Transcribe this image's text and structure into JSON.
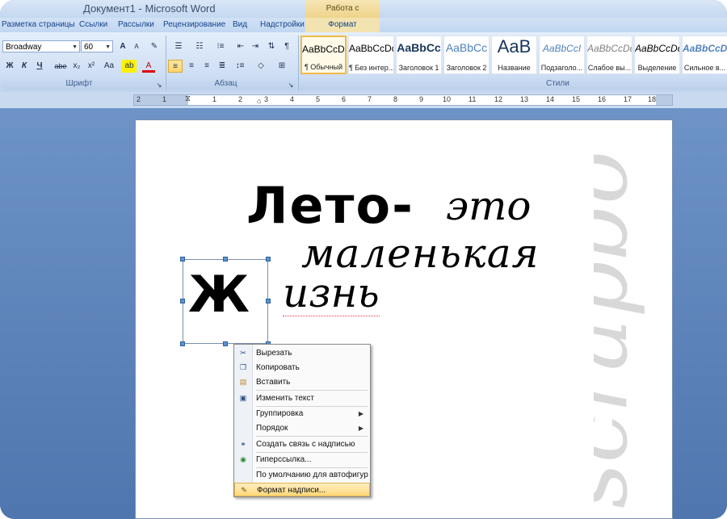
{
  "window": {
    "title": "Документ1 - Microsoft Word",
    "context_title": "Работа с надписями"
  },
  "tabs": [
    "Разметка страницы",
    "Ссылки",
    "Рассылки",
    "Рецензирование",
    "Вид",
    "Надстройки"
  ],
  "context_tab": "Формат",
  "font": {
    "name": "Broadway",
    "size": "60",
    "grow": "A",
    "shrink": "A",
    "bold": "Ж",
    "italic": "К",
    "underline": "Ч",
    "strike": "abe",
    "sub": "x₂",
    "sup": "x²",
    "case": "Aa"
  },
  "groups": {
    "font": "Шрифт",
    "paragraph": "Абзац",
    "styles": "Стили"
  },
  "styles": [
    {
      "sample": "AaBbCcDd",
      "name": "¶ Обычный"
    },
    {
      "sample": "AaBbCcDd",
      "name": "¶ Без интер..."
    },
    {
      "sample": "AaBbCc",
      "name": "Заголовок 1"
    },
    {
      "sample": "AaBbCc",
      "name": "Заголовок 2"
    },
    {
      "sample": "AaB",
      "name": "Название"
    },
    {
      "sample": "AaBbCcI",
      "name": "Подзаголо..."
    },
    {
      "sample": "AaBbCcDd",
      "name": "Слабое вы..."
    },
    {
      "sample": "AaBbCcDd",
      "name": "Выделение"
    },
    {
      "sample": "AaBbCcDd",
      "name": "Сильное в..."
    }
  ],
  "ruler": [
    "2",
    "1",
    "1",
    "1",
    "2",
    "3",
    "4",
    "5",
    "6",
    "7",
    "8",
    "9",
    "10",
    "11",
    "12",
    "13",
    "14",
    "15",
    "16",
    "17",
    "18"
  ],
  "document": {
    "line1_bold": "Лето-",
    "line1_rest": "это",
    "line2": "маленькая",
    "line3": "изнь",
    "dropcap": "Ж",
    "watermark": "scrapbo"
  },
  "context_menu": [
    {
      "label": "Вырезать",
      "icon": "scissors-icon"
    },
    {
      "label": "Копировать",
      "icon": "copy-icon"
    },
    {
      "label": "Вставить",
      "icon": "paste-icon"
    },
    {
      "label": "Изменить текст",
      "icon": "edit-text-icon"
    },
    {
      "label": "Группировка",
      "submenu": true
    },
    {
      "label": "Порядок",
      "submenu": true
    },
    {
      "label": "Создать связь с надписью",
      "icon": "link-chain-icon"
    },
    {
      "label": "Гиперссылка...",
      "icon": "globe-icon"
    },
    {
      "label": "По умолчанию для автофигур"
    },
    {
      "label": "Формат надписи...",
      "icon": "format-textbox-icon",
      "highlighted": true
    }
  ]
}
